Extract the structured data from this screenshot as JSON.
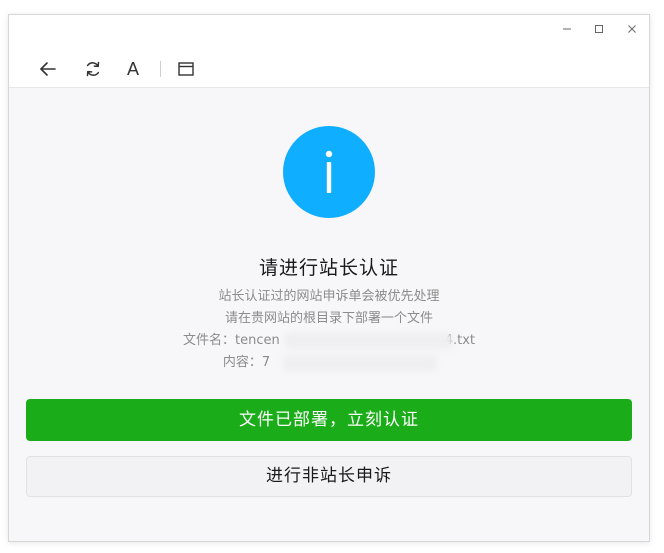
{
  "window": {
    "controls": {
      "minimize_icon": "minimize-icon",
      "maximize_icon": "maximize-icon",
      "close_icon": "close-icon"
    },
    "toolbar": {
      "back_icon": "back-arrow-icon",
      "refresh_icon": "refresh-icon",
      "font_label": "A",
      "window_icon": "window-icon"
    }
  },
  "info": {
    "icon_name": "info-icon",
    "icon_color": "#10aeff",
    "title": "请进行站长认证",
    "desc_line1": "站长认证过的网站申诉单会被优先处理",
    "desc_line2": "请在贵网站的根目录下部署一个文件",
    "file_label": "文件名：",
    "file_value_start": "tencen",
    "file_value_end": "4.txt",
    "content_label": "内容：",
    "content_value_start": "7"
  },
  "actions": {
    "primary_label": "文件已部署，立刻认证",
    "primary_color": "#1aad19",
    "secondary_label": "进行非站长申诉"
  }
}
